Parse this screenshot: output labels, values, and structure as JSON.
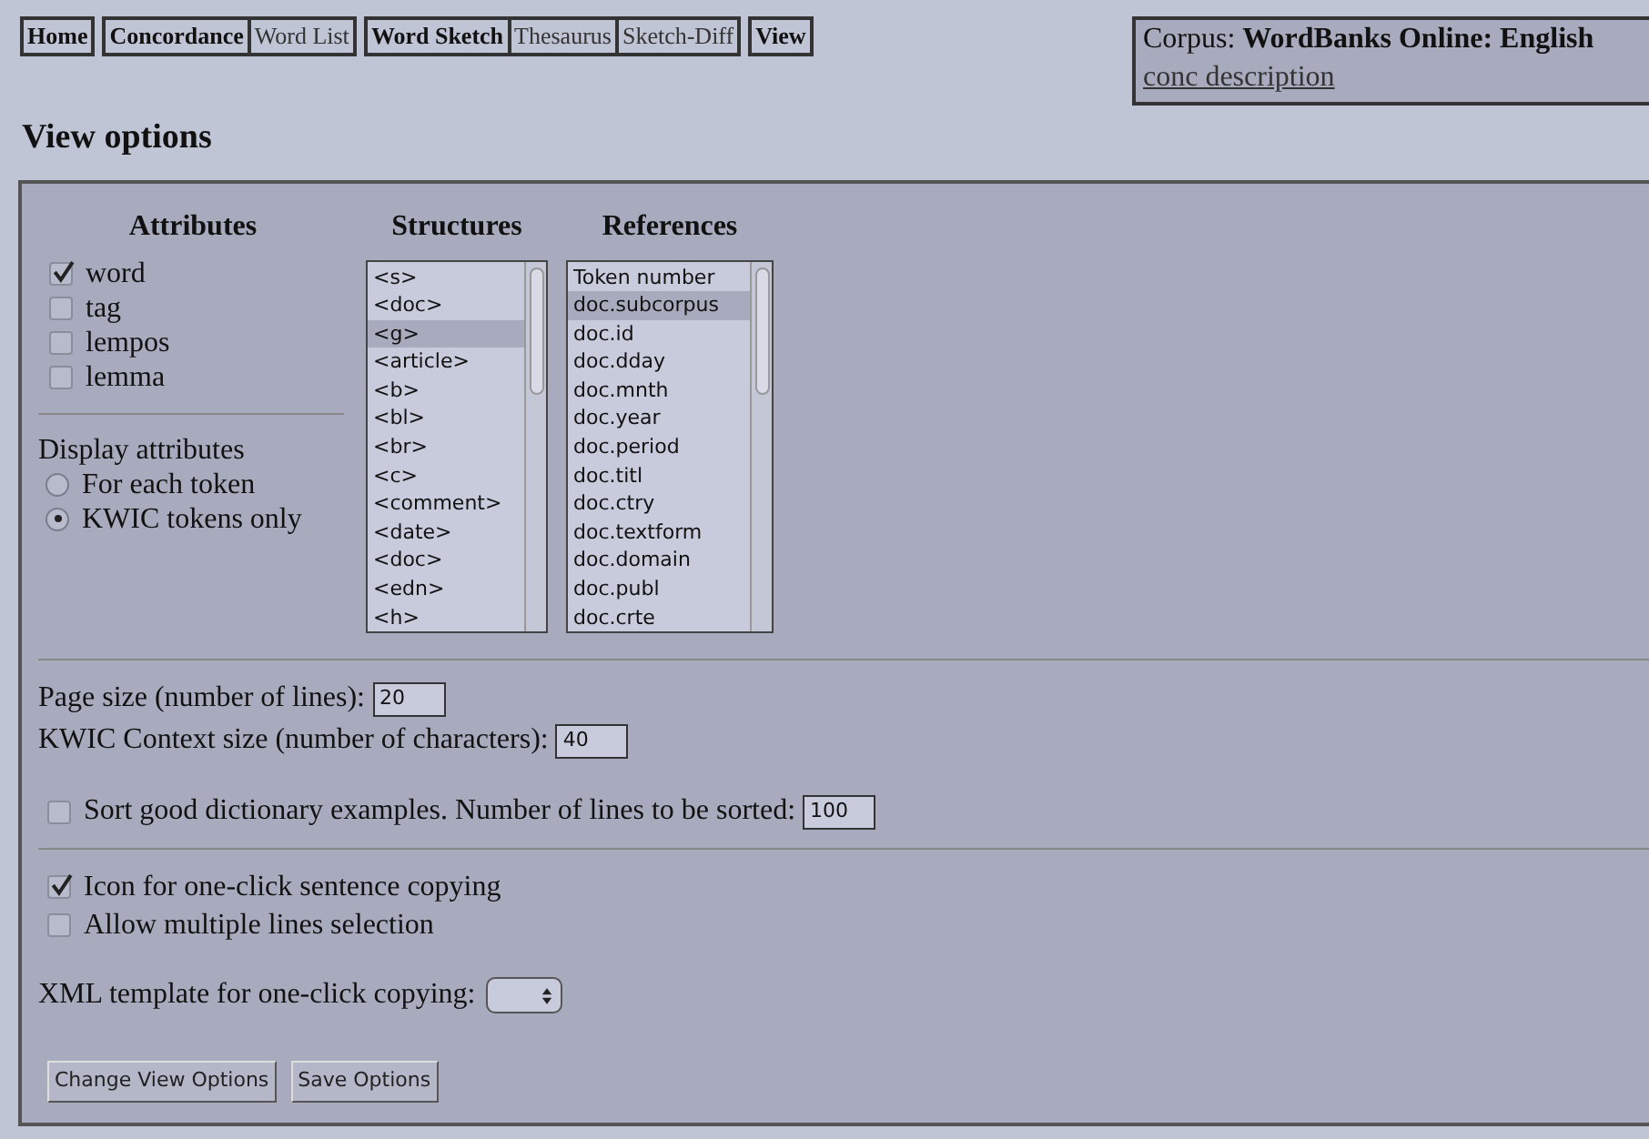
{
  "nav_groups": [
    {
      "items": [
        {
          "label": "Home",
          "bold": true
        }
      ]
    },
    {
      "items": [
        {
          "label": "Concordance",
          "bold": true
        },
        {
          "label": "Word List",
          "bold": false
        }
      ]
    },
    {
      "items": [
        {
          "label": "Word Sketch",
          "bold": true
        },
        {
          "label": "Thesaurus",
          "bold": false
        },
        {
          "label": "Sketch-Diff",
          "bold": false
        }
      ]
    },
    {
      "items": [
        {
          "label": "View",
          "bold": true
        }
      ]
    }
  ],
  "corpus_box": {
    "label": "Corpus:",
    "name": "WordBanks Online: English",
    "link": "conc description"
  },
  "page_title": "View options",
  "attributes": {
    "heading": "Attributes",
    "items": [
      {
        "label": "word",
        "checked": true
      },
      {
        "label": "tag",
        "checked": false
      },
      {
        "label": "lempos",
        "checked": false
      },
      {
        "label": "lemma",
        "checked": false
      }
    ]
  },
  "display_attributes": {
    "label": "Display attributes",
    "options": [
      {
        "label": "For each token",
        "selected": false
      },
      {
        "label": "KWIC tokens only",
        "selected": true
      }
    ]
  },
  "structures": {
    "heading": "Structures",
    "items": [
      {
        "label": "<s>",
        "selected": false
      },
      {
        "label": "<doc>",
        "selected": false
      },
      {
        "label": "<g>",
        "selected": true
      },
      {
        "label": "<article>",
        "selected": false
      },
      {
        "label": "<b>",
        "selected": false
      },
      {
        "label": "<bl>",
        "selected": false
      },
      {
        "label": "<br>",
        "selected": false
      },
      {
        "label": "<c>",
        "selected": false
      },
      {
        "label": "<comment>",
        "selected": false
      },
      {
        "label": "<date>",
        "selected": false
      },
      {
        "label": "<doc>",
        "selected": false
      },
      {
        "label": "<edn>",
        "selected": false
      },
      {
        "label": "<h>",
        "selected": false
      }
    ]
  },
  "references": {
    "heading": "References",
    "items": [
      {
        "label": "Token number",
        "selected": false
      },
      {
        "label": "doc.subcorpus",
        "selected": true
      },
      {
        "label": "doc.id",
        "selected": false
      },
      {
        "label": "doc.dday",
        "selected": false
      },
      {
        "label": "doc.mnth",
        "selected": false
      },
      {
        "label": "doc.year",
        "selected": false
      },
      {
        "label": "doc.period",
        "selected": false
      },
      {
        "label": "doc.titl",
        "selected": false
      },
      {
        "label": "doc.ctry",
        "selected": false
      },
      {
        "label": "doc.textform",
        "selected": false
      },
      {
        "label": "doc.domain",
        "selected": false
      },
      {
        "label": "doc.publ",
        "selected": false
      },
      {
        "label": "doc.crte",
        "selected": false
      }
    ]
  },
  "page_size": {
    "label": "Page size (number of lines):",
    "value": "20"
  },
  "context_size": {
    "label": "KWIC Context size (number of characters):",
    "value": "40"
  },
  "sort_examples": {
    "label": "Sort good dictionary examples. Number of lines to be sorted:",
    "checked": false,
    "value": "100"
  },
  "copy_options": [
    {
      "label": "Icon for one-click sentence copying",
      "checked": true
    },
    {
      "label": "Allow multiple lines selection",
      "checked": false
    }
  ],
  "xml_template": {
    "label": "XML template for one-click copying:"
  },
  "buttons": [
    "Change View Options",
    "Save Options"
  ]
}
